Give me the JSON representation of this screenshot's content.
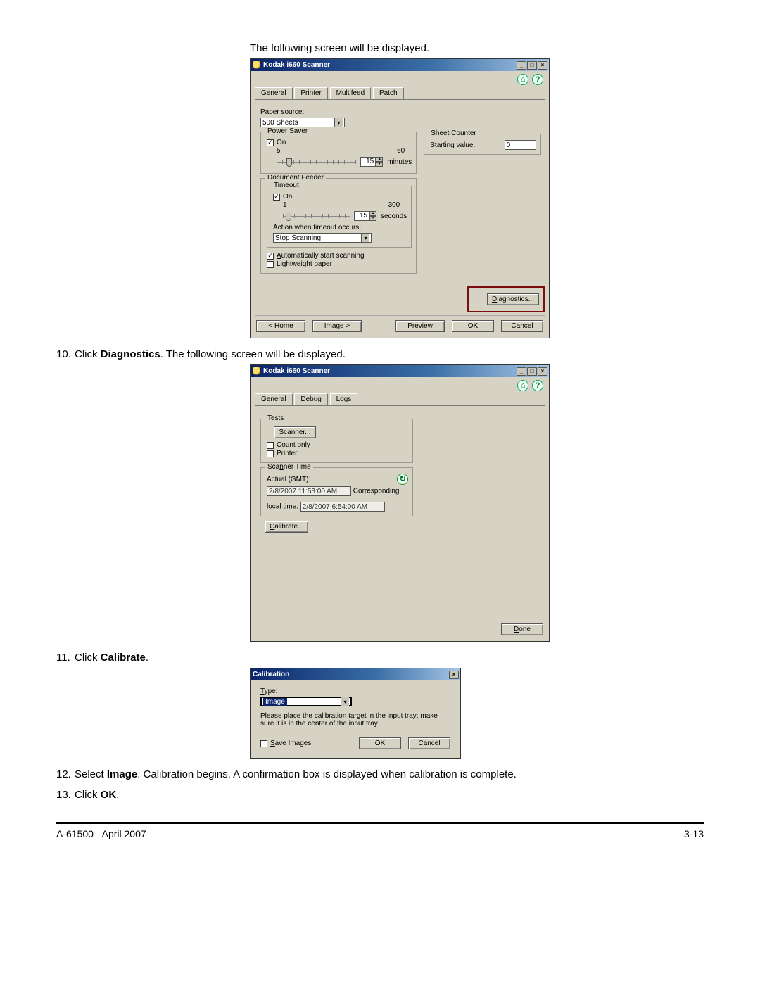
{
  "intro": "The following screen will be displayed.",
  "dialog1": {
    "title": "Kodak i660 Scanner",
    "tabs": [
      "General",
      "Printer",
      "Multifeed",
      "Patch"
    ],
    "paper_source_label": "Paper source:",
    "paper_source_value": "500 Sheets",
    "power_saver": {
      "legend": "Power Saver",
      "on": "On",
      "min": "5",
      "max": "60",
      "value": "15",
      "unit": "minutes"
    },
    "doc_feeder": {
      "legend": "Document Feeder",
      "timeout_legend": "Timeout",
      "on": "On",
      "min": "1",
      "max": "300",
      "value": "15",
      "unit": "seconds",
      "action_label": "Action when timeout occurs:",
      "action_value": "Stop Scanning",
      "auto_start": "Automatically start scanning",
      "lightweight": "Lightweight paper"
    },
    "sheet_counter": {
      "legend": "Sheet Counter",
      "label": "Starting value:",
      "value": "0"
    },
    "diagnostics_btn": "Diagnostics...",
    "bottom": {
      "home": "< Home",
      "image": "Image >",
      "preview": "Preview",
      "ok": "OK",
      "cancel": "Cancel"
    }
  },
  "step10": {
    "num": "10.",
    "pre": "Click ",
    "bold": "Diagnostics",
    "post": ". The following screen will be displayed."
  },
  "dialog2": {
    "title": "Kodak i660 Scanner",
    "tabs": [
      "General",
      "Debug",
      "Logs"
    ],
    "tests": {
      "legend": "Tests",
      "scanner_btn": "Scanner...",
      "count_only": "Count only",
      "printer": "Printer"
    },
    "scanner_time": {
      "legend": "Scanner Time",
      "actual_label": "Actual (GMT):",
      "actual_value": "2/8/2007 11:53:00 AM",
      "local_label": "Corresponding local time:",
      "local_value": "2/8/2007 6:54:00 AM"
    },
    "calibrate_btn": "Calibrate...",
    "done_btn": "Done"
  },
  "step11": {
    "num": "11.",
    "pre": "Click ",
    "bold": "Calibrate",
    "post": "."
  },
  "dialog3": {
    "title": "Calibration",
    "type_label": "Type:",
    "type_value": "Image",
    "msg": "Please place the calibration target in the input tray; make sure it is in the center of the input tray.",
    "save_images": "Save Images",
    "ok": "OK",
    "cancel": "Cancel"
  },
  "step12": {
    "num": "12.",
    "pre": "Select ",
    "bold": "Image",
    "post": ". Calibration begins. A confirmation box is displayed when calibration is complete."
  },
  "step13": {
    "num": "13.",
    "pre": "Click ",
    "bold": "OK",
    "post": "."
  },
  "footer": {
    "left1": "A-61500",
    "left2": "April 2007",
    "right": "3-13"
  }
}
